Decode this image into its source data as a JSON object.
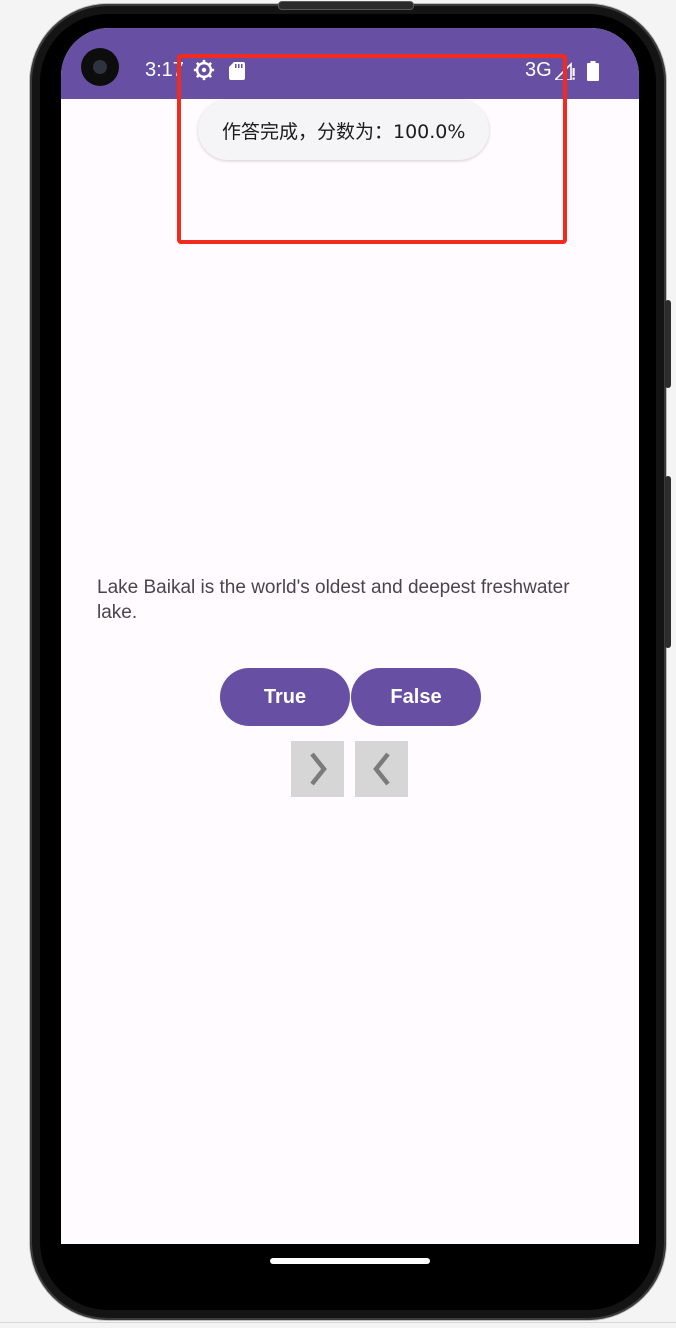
{
  "status_bar": {
    "time": "3:17",
    "network": "3G",
    "icons": [
      "settings-gear-icon",
      "sd-card-icon",
      "signal-icon",
      "battery-icon"
    ],
    "background_color": "#6750a4"
  },
  "toast": {
    "message": "作答完成，分数为：100.0%"
  },
  "quiz": {
    "question": "Lake Baikal is the world's oldest and deepest freshwater lake.",
    "true_label": "True",
    "false_label": "False",
    "next_icon": "chevron-right-icon",
    "prev_icon": "chevron-left-icon",
    "accent_color": "#6750a4"
  }
}
